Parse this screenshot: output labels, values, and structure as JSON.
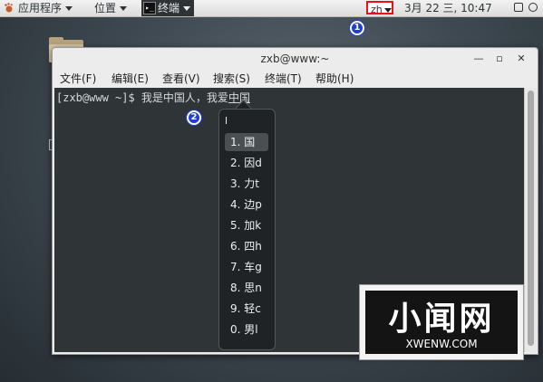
{
  "topbar": {
    "apps_label": "应用程序",
    "places_label": "位置",
    "task_label": "终端",
    "task_icon_glyph": "▸_",
    "input_method": "zh",
    "clock": "3月 22 三, 10:47",
    "badge1": "1"
  },
  "window": {
    "title": "zxb@www:~",
    "minimize_glyph": "—",
    "maximize_glyph": "▫",
    "close_glyph": "✕",
    "menu": [
      "文件(F)",
      "编辑(E)",
      "查看(V)",
      "搜索(S)",
      "终端(T)",
      "帮助(H)"
    ]
  },
  "terminal": {
    "prompt": "[zxb@www ~]$ ",
    "typed": "我是中国人，我爱",
    "preedit": "中国"
  },
  "ime": {
    "badge2": "2",
    "input": "l",
    "candidates": [
      "1. 国",
      "2. 因d",
      "3. 力t",
      "4. 边p",
      "5. 加k",
      "6. 四h",
      "7. 车g",
      "8. 思n",
      "9. 轻c",
      "0. 男l"
    ],
    "selected_index": 0
  },
  "watermark": {
    "big": "小闻网",
    "url": "XWENW.COM"
  },
  "colors": {
    "badge": "#1e3fd0",
    "highlight_box": "#ee1111",
    "terminal_bg": "#2f3537"
  }
}
